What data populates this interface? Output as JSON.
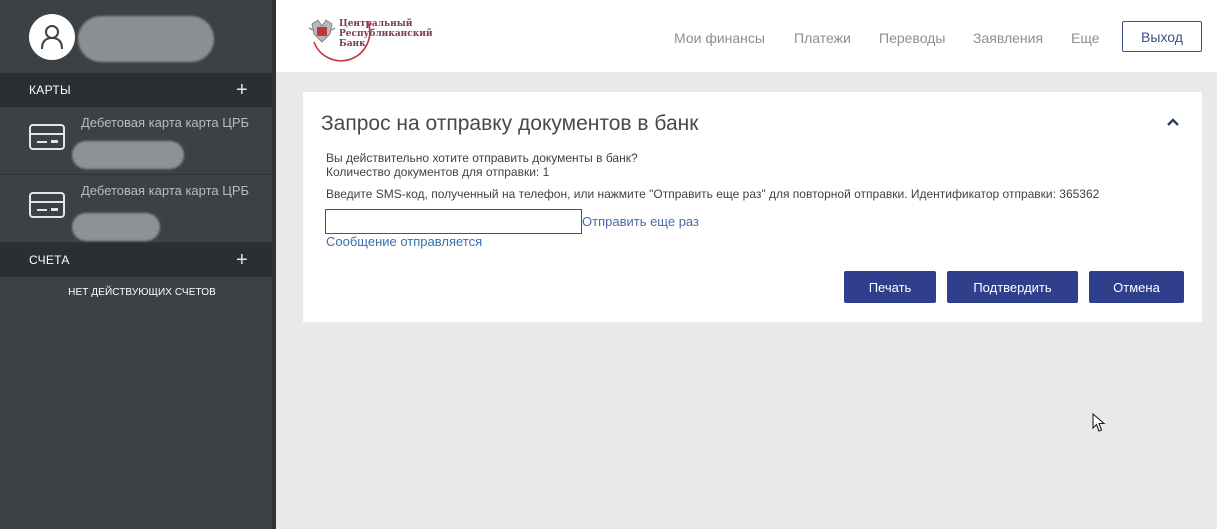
{
  "sidebar": {
    "cards_header": "КАРТЫ",
    "cards": [
      {
        "title": "Дебетовая карта карта ЦРБ"
      },
      {
        "title": "Дебетовая карта карта ЦРБ"
      }
    ],
    "accounts_header": "СЧЕТА",
    "no_accounts": "НЕТ ДЕЙСТВУЮЩИХ СЧЕТОВ"
  },
  "header": {
    "logo_lines": [
      "Центральный",
      "Республиканский",
      "Банк"
    ],
    "nav": [
      "Мои финансы",
      "Платежи",
      "Переводы",
      "Заявления",
      "Еще"
    ],
    "logout": "Выход"
  },
  "panel": {
    "title": "Запрос на отправку документов в банк",
    "question": "Вы действительно хотите отправить документы в банк?",
    "count": "Количество документов для отправки: 1",
    "instruction": "Введите SMS-код, полученный на телефон, или нажмите \"Отправить еще раз\" для повторной отправки. Идентификатор отправки: 365362",
    "sms_value": "",
    "resend": "Отправить еще раз",
    "status": "Сообщение отправляется",
    "buttons": {
      "print": "Печать",
      "confirm": "Подтвердить",
      "cancel": "Отмена"
    }
  },
  "colors": {
    "sidebar": "#3c4146",
    "section_header": "#2b2f33",
    "primary_button": "#303f8c",
    "link": "#3c6fb0",
    "background": "#e9e9e9"
  },
  "icons": [
    "user-icon",
    "plus-icon",
    "card-icon",
    "chevron-up-icon",
    "mouse-cursor-icon",
    "bank-emblem-icon"
  ]
}
